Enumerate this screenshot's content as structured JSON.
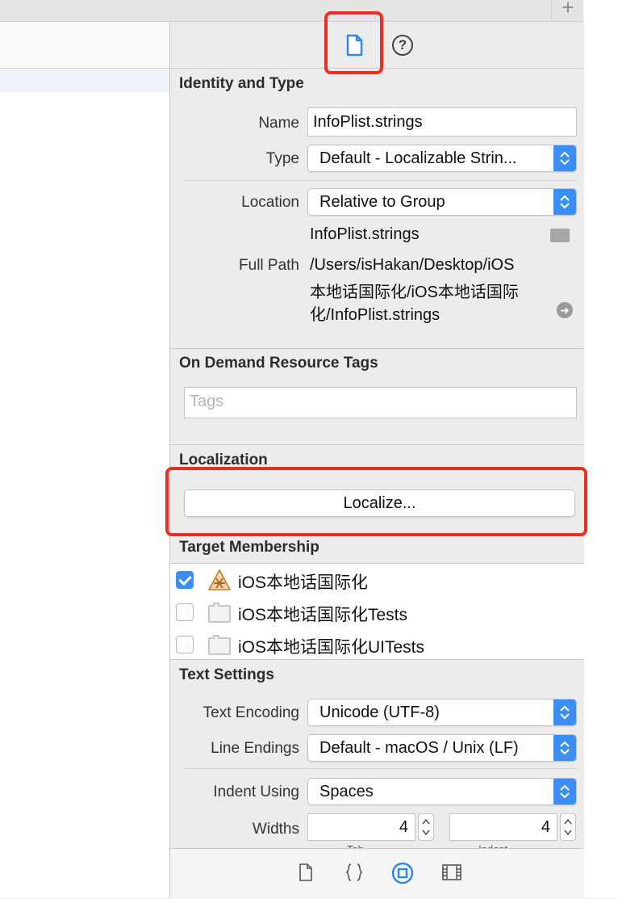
{
  "topbar": {
    "add_label": "+"
  },
  "inspector_tabs": [
    {
      "icon": "file-icon",
      "selected": true
    },
    {
      "icon": "help-icon",
      "label": "?"
    }
  ],
  "identity": {
    "title": "Identity and Type",
    "name_label": "Name",
    "name_value": "InfoPlist.strings",
    "type_label": "Type",
    "type_value": "Default - Localizable Strin...",
    "location_label": "Location",
    "location_value": "Relative to Group",
    "location_file": "InfoPlist.strings",
    "fullpath_label": "Full Path",
    "fullpath_line1": "/Users/isHakan/Desktop/iOS",
    "fullpath_line2": "本地话国际化/iOS本地话国际",
    "fullpath_line3": "化/InfoPlist.strings"
  },
  "on_demand": {
    "title": "On Demand Resource Tags",
    "tags_placeholder": "Tags"
  },
  "localization": {
    "title": "Localization",
    "button_label": "Localize..."
  },
  "target_membership": {
    "title": "Target Membership",
    "targets": [
      {
        "label": "iOS本地话国际化",
        "checked": true,
        "icon": "app-target-icon"
      },
      {
        "label": "iOS本地话国际化Tests",
        "checked": false,
        "icon": "test-bundle-icon"
      },
      {
        "label": "iOS本地话国际化UITests",
        "checked": false,
        "icon": "test-bundle-icon"
      }
    ]
  },
  "text_settings": {
    "title": "Text Settings",
    "encoding_label": "Text Encoding",
    "encoding_value": "Unicode (UTF-8)",
    "line_endings_label": "Line Endings",
    "line_endings_value": "Default - macOS / Unix (LF)",
    "indent_label": "Indent Using",
    "indent_value": "Spaces",
    "widths_label": "Widths",
    "tab_width": "4",
    "indent_width": "4",
    "tab_caption_partial": "Tab",
    "indent_caption_partial": "Indent"
  },
  "library_tabs": [
    {
      "icon": "file-template-icon"
    },
    {
      "icon": "code-snippet-icon"
    },
    {
      "icon": "object-library-icon",
      "selected": true
    },
    {
      "icon": "media-library-icon"
    }
  ],
  "colors": {
    "accent": "#3a8ef6",
    "highlight_box": "#ee2c24"
  }
}
